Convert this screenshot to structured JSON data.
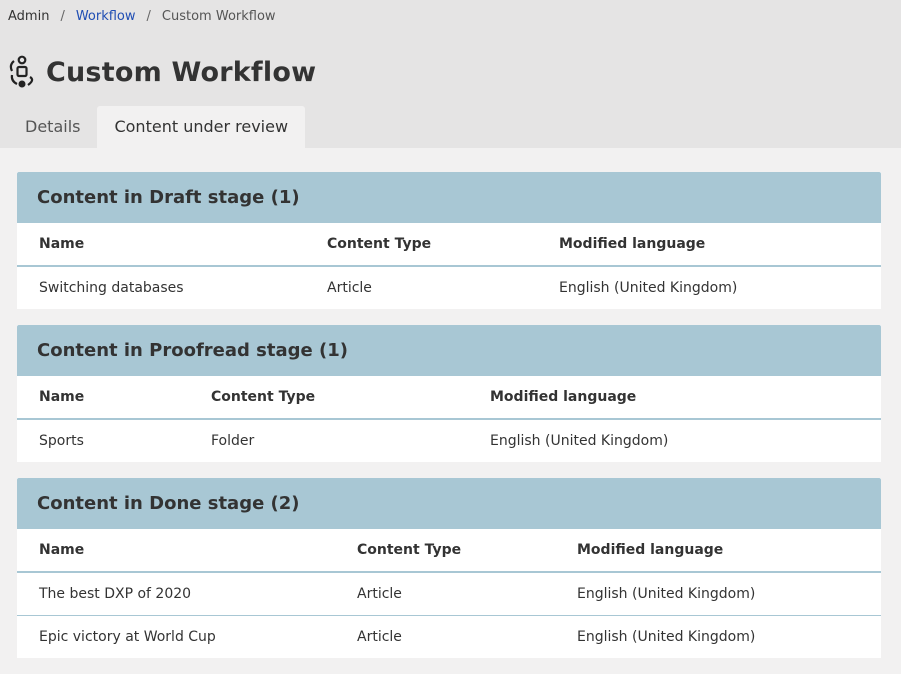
{
  "breadcrumb": [
    {
      "label": "Admin"
    },
    {
      "label": "Workflow"
    },
    {
      "label": "Custom Workflow"
    }
  ],
  "page": {
    "title": "Custom Workflow",
    "icon": "workflow-icon"
  },
  "tabs": [
    {
      "label": "Details",
      "active": false
    },
    {
      "label": "Content under review",
      "active": true
    }
  ],
  "sections": [
    {
      "title": "Content in Draft stage (1)",
      "columns": [
        "Name",
        "Content Type",
        "Modified language"
      ],
      "rows": [
        [
          "Switching databases",
          "Article",
          "English (United Kingdom)"
        ]
      ]
    },
    {
      "title": "Content in Proofread stage (1)",
      "columns": [
        "Name",
        "Content Type",
        "Modified language"
      ],
      "rows": [
        [
          "Sports",
          "Folder",
          "English (United Kingdom)"
        ]
      ]
    },
    {
      "title": "Content in Done stage (2)",
      "columns": [
        "Name",
        "Content Type",
        "Modified language"
      ],
      "rows": [
        [
          "The best DXP of 2020",
          "Article",
          "English (United Kingdom)"
        ],
        [
          "Epic victory at World Cup",
          "Article",
          "English (United Kingdom)"
        ]
      ]
    }
  ]
}
